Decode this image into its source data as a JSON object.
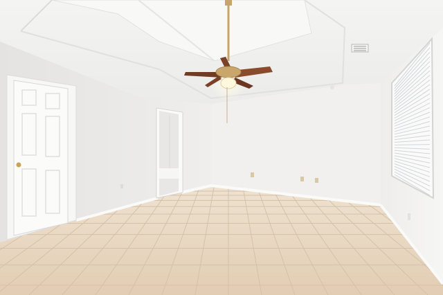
{
  "scene": {
    "subject": "empty-room-with-ceiling-fan",
    "colors": {
      "wall_left": "#ebeae8",
      "wall_back": "#f0efed",
      "wall_right": "#f2f1ef",
      "ceiling": "#f3f3f2",
      "tray_ceiling": "#f7f7f6",
      "floor_tile": "#e9d7c1",
      "grout": "#d6c3ab",
      "baseboard": "#f6f6f5",
      "door": "#f8f8f7",
      "fan_blade": "#8a4a2c",
      "fan_brass": "#c7a46a",
      "light_glow": "#fff4d6",
      "window_blind": "#f4f5f6"
    }
  }
}
